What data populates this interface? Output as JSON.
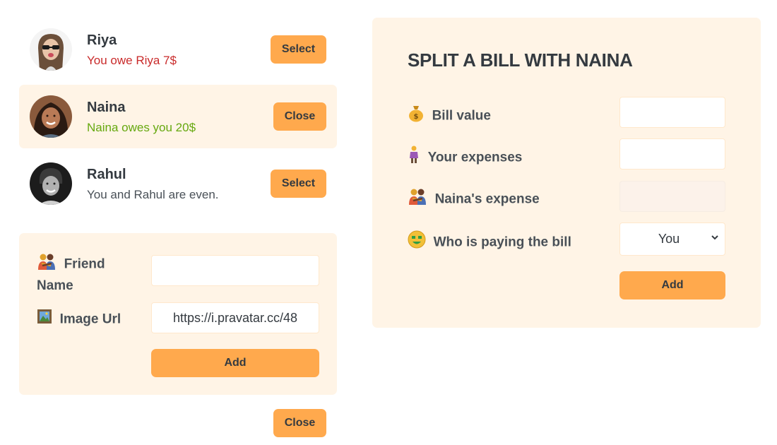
{
  "friends": [
    {
      "name": "Riya",
      "status": "You owe Riya 7$",
      "status_type": "red",
      "button": "Select",
      "selected": false,
      "avatar": "avatar-riya"
    },
    {
      "name": "Naina",
      "status": "Naina owes you 20$",
      "status_type": "green",
      "button": "Close",
      "selected": true,
      "avatar": "avatar-naina"
    },
    {
      "name": "Rahul",
      "status": "You and Rahul are even.",
      "status_type": "neutral",
      "button": "Select",
      "selected": false,
      "avatar": "avatar-rahul"
    }
  ],
  "add_friend": {
    "name_label_line1": "Friend",
    "name_label_line2": "Name",
    "name_icon": "people-hugging-icon",
    "name_value": "",
    "image_label": "Image Url",
    "image_icon": "framed-picture-icon",
    "image_value": "https://i.pravatar.cc/48",
    "add_button": "Add"
  },
  "close_button": "Close",
  "split_bill": {
    "title": "SPLIT A BILL WITH NAINA",
    "bill_label": "Bill value",
    "bill_icon": "money-bag-icon",
    "bill_value": "",
    "your_label": "Your expenses",
    "your_icon": "woman-standing-icon",
    "your_value": "",
    "friend_label": "Naina's expense",
    "friend_icon": "people-hugging-icon",
    "friend_value": "",
    "payer_label": "Who is paying the bill",
    "payer_icon": "money-mouth-face-icon",
    "payer_value": "You",
    "add_button": "Add"
  },
  "colors": {
    "accent": "#ffa94d",
    "panel": "#fff4e6",
    "owe_red": "#c92a2a",
    "owed_green": "#66a80f"
  }
}
